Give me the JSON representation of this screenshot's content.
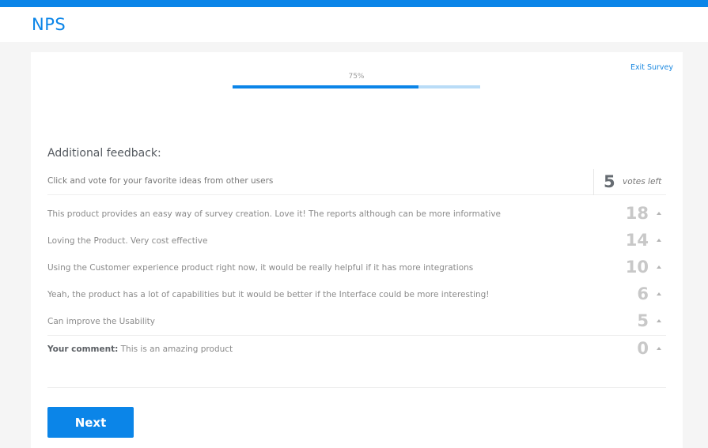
{
  "app": {
    "title": "NPS",
    "accent_color": "#0b85e8"
  },
  "survey": {
    "exit_label": "Exit Survey",
    "progress": {
      "label": "75%",
      "percent": 75
    },
    "section_title": "Additional feedback:",
    "instruction": "Click and vote for your favorite ideas from other users",
    "votes_left": {
      "count": "5",
      "label": "votes left"
    },
    "ideas": [
      {
        "text": "This product provides an easy way of survey creation. Love it! The reports although can be more informative",
        "votes": "18"
      },
      {
        "text": "Loving the Product. Very cost effective",
        "votes": "14"
      },
      {
        "text": "Using the Customer experience product right now, it would be really helpful if it has more integrations",
        "votes": "10"
      },
      {
        "text": "Yeah, the product has a lot of capabilities but it would be better if the Interface could be more interesting!",
        "votes": "6"
      },
      {
        "text": "Can improve the Usability",
        "votes": "5"
      }
    ],
    "your_comment": {
      "label": "Your comment:",
      "text": " This is an amazing product",
      "votes": "0"
    },
    "next_label": "Next"
  }
}
